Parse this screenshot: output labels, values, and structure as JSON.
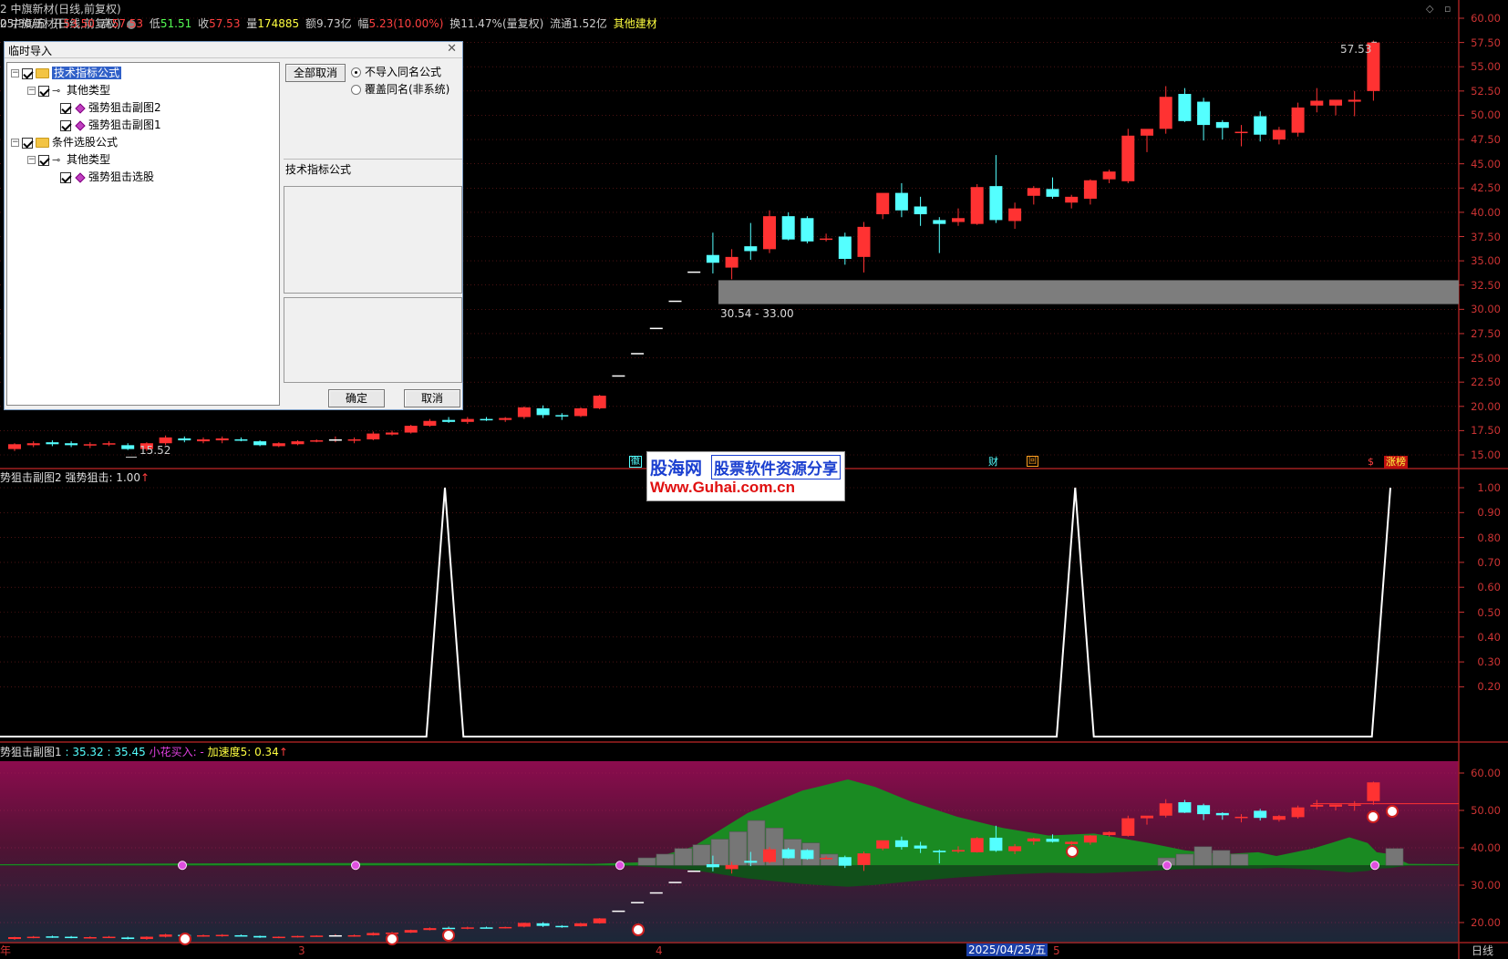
{
  "header": {
    "title": "2 中旗新材(日线,前复权)",
    "date": "05/30/五",
    "open_label": "开",
    "open": "53.50",
    "high_label": "高",
    "high": "57.53",
    "low_label": "低",
    "low": "51.51",
    "close_label": "收",
    "close": "57.53",
    "vol_label": "量",
    "vol": "174885",
    "amount_label": "额",
    "amount": "9.73亿",
    "change_label": "幅",
    "change": "5.23(10.00%)",
    "turnover": "换11.47%(量复权)",
    "float": "流通1.52亿",
    "sector": "其他建材"
  },
  "price_axis": [
    "60.00",
    "57.50",
    "55.00",
    "52.50",
    "50.00",
    "47.50",
    "45.00",
    "42.50",
    "40.00",
    "37.50",
    "35.00",
    "32.50",
    "30.00",
    "27.50",
    "25.00",
    "22.50",
    "20.00",
    "17.50",
    "15.00"
  ],
  "high_marker": "57.53",
  "low_marker": "15.52",
  "zone_label": "30.54 - 33.00",
  "event_markers": [
    "徽",
    "财",
    "回",
    "$",
    "涨榜"
  ],
  "panel2": {
    "header": "势狙击副图2 强势狙击: 1.00",
    "axis": [
      "1.00",
      "0.90",
      "0.80",
      "0.70",
      "0.60",
      "0.50",
      "0.40",
      "0.30",
      "0.20"
    ],
    "signal_values": [
      0,
      0,
      0,
      0,
      0,
      0,
      0,
      0,
      0,
      0,
      0,
      0,
      0,
      0,
      0,
      0,
      0,
      0,
      0,
      0,
      0,
      0,
      0,
      0,
      1,
      0,
      0,
      0,
      0,
      0,
      0,
      0,
      0,
      0,
      0,
      0,
      0,
      0,
      0,
      0,
      0,
      0,
      0,
      0,
      0,
      0,
      0,
      0,
      0,
      0,
      0,
      0,
      0,
      0,
      0,
      0,
      0,
      0,
      1,
      0,
      0,
      0,
      0,
      0,
      0,
      0,
      0,
      0,
      0,
      0,
      0,
      0,
      0,
      0,
      0,
      1
    ]
  },
  "panel3": {
    "header_prefix": "势狙击副图1",
    "val1": ": 35.32",
    "val2": ": 35.45",
    "flower": "小花买入: -",
    "accel": "加速度5: 0.34",
    "axis": [
      "60.00",
      "50.00",
      "40.00",
      "30.00",
      "20.00"
    ]
  },
  "date_axis": {
    "labels": [
      "年",
      "3",
      "4",
      "2025/04/25/五",
      "5"
    ],
    "period": "日线"
  },
  "dialog": {
    "title": "临时导入",
    "tree": [
      {
        "label": "技术指标公式"
      },
      {
        "label": "其他类型"
      },
      {
        "label": "强势狙击副图2"
      },
      {
        "label": "强势狙击副图1"
      },
      {
        "label": "条件选股公式"
      },
      {
        "label": "其他类型"
      },
      {
        "label": "强势狙击选股"
      }
    ],
    "cancel_all": "全部取消",
    "radio1": "不导入同名公式",
    "radio2": "覆盖同名(非系统)",
    "info_title": "技术指标公式",
    "ok": "确定",
    "cancel": "取消"
  },
  "watermark": {
    "logo": "股海网",
    "slogan": "股票软件资源分享",
    "url": "Www.Guhai.com.cn"
  },
  "colors": {
    "up": "#ff3232",
    "down": "#54ffff",
    "axis": "#cc3333",
    "grid": "#7a1e1e",
    "signal": "#ffffff"
  },
  "chart_data": {
    "type": "candlestick",
    "candles": [
      [
        15.6,
        16.2,
        15.4,
        16.1
      ],
      [
        16.0,
        16.4,
        15.8,
        16.2
      ],
      [
        16.3,
        16.5,
        15.9,
        16.1
      ],
      [
        16.2,
        16.4,
        15.8,
        16.0
      ],
      [
        16.0,
        16.3,
        15.7,
        16.1
      ],
      [
        16.1,
        16.4,
        15.9,
        16.2
      ],
      [
        16.0,
        16.2,
        15.5,
        15.6
      ],
      [
        15.6,
        16.3,
        15.4,
        16.2
      ],
      [
        16.2,
        17.0,
        16.0,
        16.8
      ],
      [
        16.7,
        16.9,
        16.3,
        16.5
      ],
      [
        16.4,
        16.8,
        16.2,
        16.6
      ],
      [
        16.5,
        16.9,
        16.2,
        16.7
      ],
      [
        16.6,
        16.8,
        16.4,
        16.5
      ],
      [
        16.4,
        16.5,
        15.9,
        16.0
      ],
      [
        15.9,
        16.3,
        15.8,
        16.2
      ],
      [
        16.1,
        16.5,
        16.0,
        16.4
      ],
      [
        16.4,
        16.6,
        16.3,
        16.5
      ],
      [
        16.6,
        16.9,
        16.3,
        16.6
      ],
      [
        16.5,
        16.8,
        16.2,
        16.6
      ],
      [
        16.6,
        17.4,
        16.5,
        17.2
      ],
      [
        17.1,
        17.5,
        17.0,
        17.3
      ],
      [
        17.3,
        18.1,
        17.2,
        18.0
      ],
      [
        18.0,
        18.7,
        17.9,
        18.5
      ],
      [
        18.6,
        18.9,
        18.3,
        18.4
      ],
      [
        18.4,
        18.9,
        18.2,
        18.7
      ],
      [
        18.7,
        18.9,
        18.5,
        18.6
      ],
      [
        18.6,
        18.9,
        18.4,
        18.8
      ],
      [
        18.9,
        20.0,
        18.7,
        19.9
      ],
      [
        19.8,
        20.1,
        18.8,
        19.1
      ],
      [
        19.1,
        19.3,
        18.6,
        19.0
      ],
      [
        19.0,
        19.9,
        18.9,
        19.8
      ],
      [
        19.8,
        21.2,
        19.7,
        21.1
      ],
      [
        23.2,
        23.2,
        23.2,
        23.2
      ],
      [
        25.5,
        25.5,
        25.5,
        25.5
      ],
      [
        28.1,
        28.1,
        28.1,
        28.1
      ],
      [
        30.9,
        30.9,
        30.9,
        30.9
      ],
      [
        33.9,
        33.9,
        33.9,
        33.9
      ],
      [
        35.6,
        37.9,
        33.7,
        34.8
      ],
      [
        34.3,
        36.2,
        33.1,
        35.4
      ],
      [
        36.5,
        38.9,
        35.1,
        36.0
      ],
      [
        36.2,
        40.2,
        35.8,
        39.6
      ],
      [
        39.6,
        40.0,
        37.1,
        37.2
      ],
      [
        39.4,
        39.6,
        36.8,
        37.0
      ],
      [
        37.2,
        37.8,
        37.0,
        37.3
      ],
      [
        37.5,
        37.9,
        34.6,
        35.2
      ],
      [
        35.4,
        39.0,
        33.8,
        38.5
      ],
      [
        39.8,
        41.5,
        39.3,
        42.0
      ],
      [
        42.0,
        43.0,
        39.5,
        40.2
      ],
      [
        40.6,
        41.6,
        38.6,
        39.8
      ],
      [
        39.2,
        39.5,
        35.8,
        38.8
      ],
      [
        39.0,
        40.4,
        38.6,
        39.4
      ],
      [
        38.8,
        42.9,
        38.7,
        42.6
      ],
      [
        42.7,
        45.9,
        38.9,
        39.2
      ],
      [
        39.1,
        41.0,
        38.3,
        40.4
      ],
      [
        41.7,
        42.7,
        40.8,
        42.5
      ],
      [
        42.4,
        43.6,
        41.4,
        41.6
      ],
      [
        41.0,
        41.8,
        40.4,
        41.6
      ],
      [
        41.4,
        43.4,
        40.8,
        43.3
      ],
      [
        43.4,
        44.4,
        43.0,
        44.2
      ],
      [
        43.2,
        48.6,
        43.0,
        47.9
      ],
      [
        47.9,
        48.4,
        46.2,
        48.6
      ],
      [
        48.6,
        53.0,
        48.1,
        51.9
      ],
      [
        52.2,
        52.8,
        49.3,
        49.4
      ],
      [
        51.4,
        51.8,
        47.4,
        49.0
      ],
      [
        49.3,
        49.5,
        47.5,
        48.7
      ],
      [
        48.2,
        49.0,
        46.8,
        48.3
      ],
      [
        49.9,
        50.4,
        47.3,
        48.0
      ],
      [
        47.5,
        48.8,
        47.0,
        48.5
      ],
      [
        48.2,
        51.3,
        47.8,
        50.8
      ],
      [
        51.0,
        52.8,
        50.3,
        51.5
      ],
      [
        51.0,
        51.3,
        50.0,
        51.6
      ],
      [
        51.4,
        52.5,
        49.9,
        51.6
      ],
      [
        52.5,
        57.7,
        51.5,
        57.5
      ]
    ],
    "high": 57.53,
    "low": 15.52,
    "zone": [
      30.54,
      33.0
    ]
  }
}
